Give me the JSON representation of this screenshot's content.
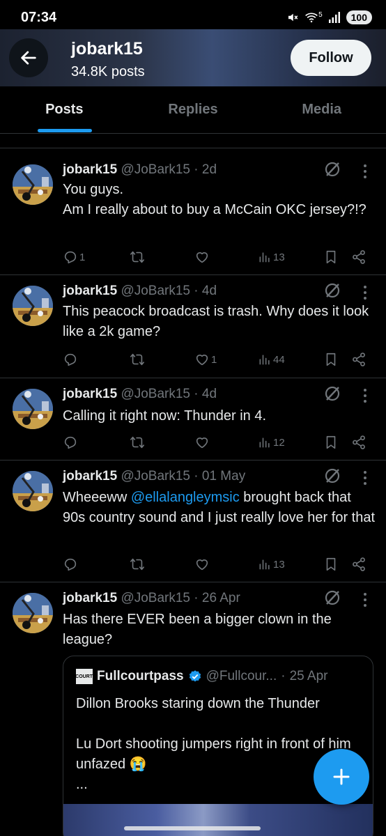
{
  "status_bar": {
    "time": "07:34",
    "network": "5",
    "battery": "100"
  },
  "header": {
    "title": "jobark15",
    "subtitle": "34.8K posts",
    "follow_label": "Follow"
  },
  "tabs": [
    {
      "label": "Posts",
      "active": true
    },
    {
      "label": "Replies",
      "active": false
    },
    {
      "label": "Media",
      "active": false
    }
  ],
  "posts": [
    {
      "name": "jobark15",
      "handle": "@JoBark15",
      "time": "2d",
      "text_lines": [
        "You guys.",
        "Am I really about to buy a McCain OKC jersey?!?"
      ],
      "replies": "1",
      "reposts": "",
      "likes": "",
      "views": "13"
    },
    {
      "name": "jobark15",
      "handle": "@JoBark15",
      "time": "4d",
      "text_lines": [
        "This peacock broadcast is trash. Why does it look like a 2k game?"
      ],
      "replies": "",
      "reposts": "",
      "likes": "1",
      "views": "44"
    },
    {
      "name": "jobark15",
      "handle": "@JoBark15",
      "time": "4d",
      "text_lines": [
        "Calling it right now: Thunder in 4."
      ],
      "replies": "",
      "reposts": "",
      "likes": "",
      "views": "12"
    },
    {
      "name": "jobark15",
      "handle": "@JoBark15",
      "time": "01 May",
      "text_before": "Wheeeww ",
      "mention": "@ellalangleymsic",
      "text_after": " brought back that 90s country sound and I just really love her for that",
      "replies": "",
      "reposts": "",
      "likes": "",
      "views": "13"
    },
    {
      "name": "jobark15",
      "handle": "@JoBark15",
      "time": "26 Apr",
      "text_lines": [
        "Has there EVER been a bigger clown in the league?"
      ],
      "quote": {
        "name": "Fullcourtpass",
        "handle": "@Fullcour...",
        "time": "25 Apr",
        "logo_text": "FULL COURT PASS",
        "text_p1": "Dillon Brooks staring down the Thunder",
        "text_p2": "Lu Dort shooting jumpers right in front of him unfazed 😭",
        "ellipsis": "..."
      }
    }
  ],
  "colors": {
    "accent": "#1d9bf0",
    "muted": "#71767b",
    "text": "#e7e9ea",
    "divider": "#2f3336"
  },
  "icons": [
    "back-arrow-icon",
    "grok-icon",
    "more-vertical-icon",
    "reply-icon",
    "repost-icon",
    "like-icon",
    "views-icon",
    "bookmark-icon",
    "share-icon",
    "verified-badge-icon",
    "compose-plus-icon"
  ]
}
